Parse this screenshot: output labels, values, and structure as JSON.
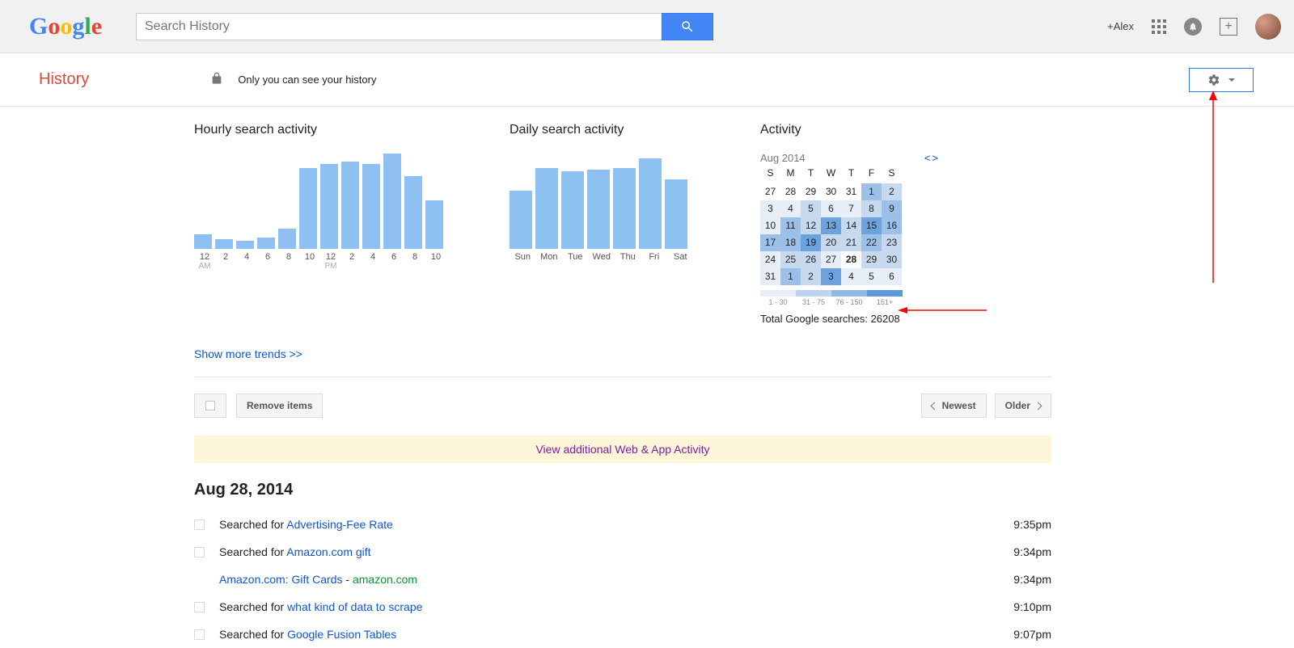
{
  "header": {
    "search_placeholder": "Search History",
    "plus_name": "+Alex"
  },
  "subheader": {
    "title": "History",
    "privacy_note": "Only you can see your history"
  },
  "hourly": {
    "title": "Hourly search activity",
    "labels": [
      "12",
      "2",
      "4",
      "6",
      "8",
      "10",
      "12",
      "2",
      "4",
      "6",
      "8",
      "10"
    ],
    "am": "AM",
    "pm": "PM"
  },
  "daily": {
    "title": "Daily search activity",
    "labels": [
      "Sun",
      "Mon",
      "Tue",
      "Wed",
      "Thu",
      "Fri",
      "Sat"
    ]
  },
  "activity": {
    "title": "Activity",
    "month": "Aug 2014",
    "dow": [
      "S",
      "M",
      "T",
      "W",
      "T",
      "F",
      "S"
    ],
    "legend": [
      "1 - 30",
      "31 - 75",
      "76 - 150",
      "151+"
    ],
    "total_label": "Total Google searches: ",
    "total_value": "26208"
  },
  "trends_link": "Show more trends >>",
  "toolbar": {
    "remove": "Remove items",
    "newest": "Newest",
    "older": "Older"
  },
  "banner": "View additional Web & App Activity",
  "date_heading": "Aug 28, 2014",
  "entries": [
    {
      "type": "search",
      "prefix": "Searched for ",
      "query": "Advertising-Fee Rate",
      "time": "9:35pm"
    },
    {
      "type": "search",
      "prefix": "Searched for ",
      "query": "Amazon.com gift",
      "time": "9:34pm"
    },
    {
      "type": "visit",
      "title": "Amazon.com: Gift Cards",
      "domain": "amazon.com",
      "time": "9:34pm"
    },
    {
      "type": "search",
      "prefix": "Searched for ",
      "query": "what kind of data to scrape",
      "time": "9:10pm"
    },
    {
      "type": "search",
      "prefix": "Searched for ",
      "query": "Google Fusion Tables",
      "time": "9:07pm"
    }
  ],
  "chart_data": [
    {
      "type": "bar",
      "title": "Hourly search activity",
      "categories": [
        "12 AM",
        "2 AM",
        "4 AM",
        "6 AM",
        "8 AM",
        "10 AM",
        "12 PM",
        "2 PM",
        "4 PM",
        "6 PM",
        "8 PM",
        "10 PM"
      ],
      "values": [
        18,
        12,
        10,
        14,
        25,
        100,
        105,
        108,
        105,
        118,
        90,
        60
      ],
      "xlabel": "",
      "ylabel": "",
      "ylim": [
        0,
        120
      ]
    },
    {
      "type": "bar",
      "title": "Daily search activity",
      "categories": [
        "Sun",
        "Mon",
        "Tue",
        "Wed",
        "Thu",
        "Fri",
        "Sat"
      ],
      "values": [
        72,
        100,
        96,
        98,
        100,
        112,
        86
      ],
      "xlabel": "",
      "ylabel": "",
      "ylim": [
        0,
        120
      ]
    },
    {
      "type": "heatmap",
      "title": "Activity calendar Aug 2014",
      "rows": [
        {
          "days": [
            27,
            28,
            29,
            30,
            31,
            1,
            2
          ],
          "intensity": [
            0,
            0,
            0,
            0,
            0,
            3,
            2
          ]
        },
        {
          "days": [
            3,
            4,
            5,
            6,
            7,
            8,
            9
          ],
          "intensity": [
            1,
            1,
            2,
            1,
            1,
            2,
            3
          ]
        },
        {
          "days": [
            10,
            11,
            12,
            13,
            14,
            15,
            16
          ],
          "intensity": [
            1,
            3,
            2,
            4,
            2,
            4,
            3
          ]
        },
        {
          "days": [
            17,
            18,
            19,
            20,
            21,
            22,
            23
          ],
          "intensity": [
            3,
            3,
            4,
            2,
            2,
            3,
            2
          ]
        },
        {
          "days": [
            24,
            25,
            26,
            27,
            28,
            29,
            30
          ],
          "intensity": [
            1,
            2,
            2,
            1,
            0,
            2,
            2
          ]
        },
        {
          "days": [
            31,
            1,
            2,
            3,
            4,
            5,
            6
          ],
          "intensity": [
            1,
            3,
            2,
            4,
            1,
            1,
            1
          ]
        }
      ],
      "legend": [
        "1 - 30",
        "31 - 75",
        "76 - 150",
        "151+"
      ],
      "today": 28
    }
  ]
}
